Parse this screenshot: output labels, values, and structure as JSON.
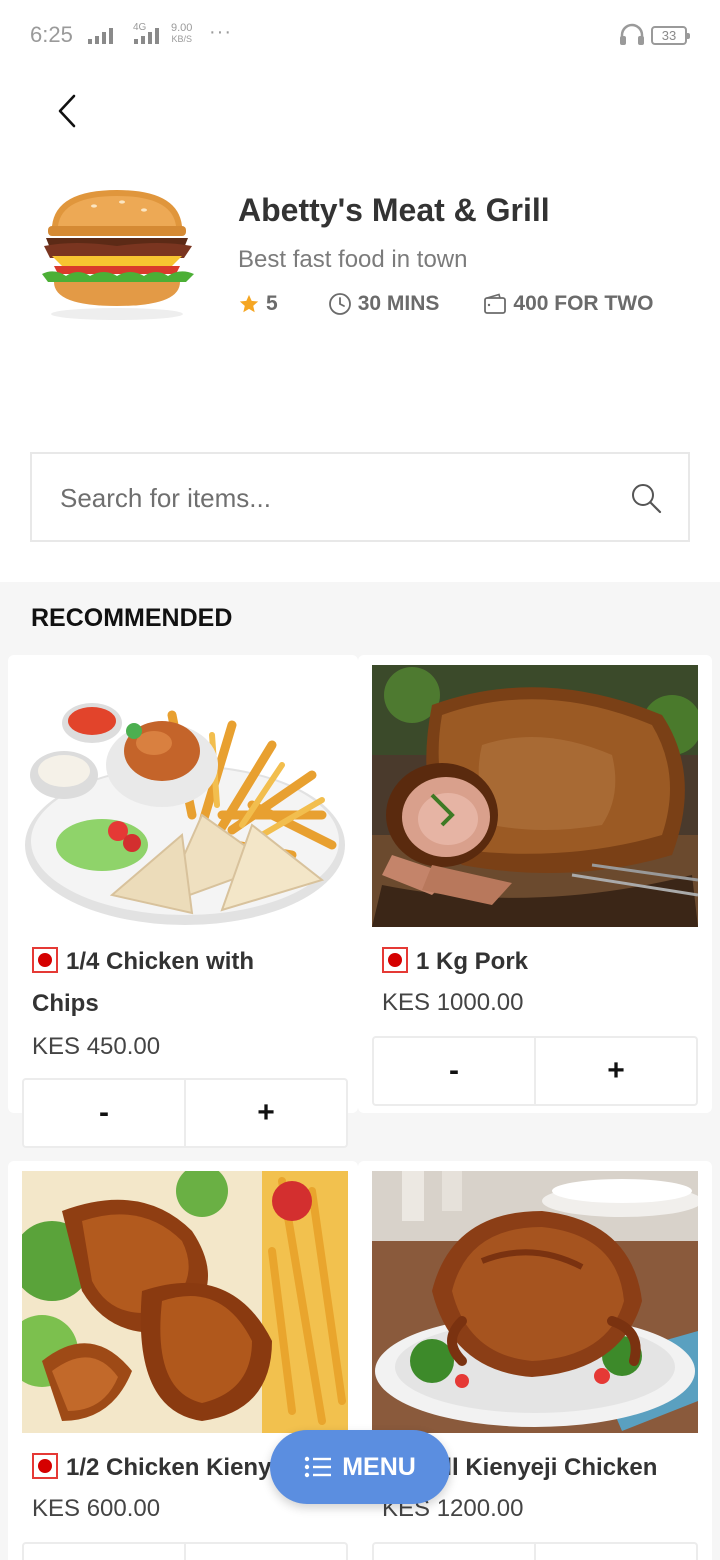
{
  "status_bar": {
    "time": "6:25",
    "network": "4G",
    "speed_value": "9.00",
    "speed_unit": "KB/S",
    "more": "···",
    "battery": "33"
  },
  "restaurant": {
    "name": "Abetty's Meat & Grill",
    "tagline": "Best fast food in town",
    "rating": "5",
    "delivery_time": "30 MINS",
    "cost_for_two": "400 FOR TWO"
  },
  "search": {
    "placeholder": "Search for items..."
  },
  "section": {
    "title": "RECOMMENDED"
  },
  "items": [
    {
      "name_line1": "1/4 Chicken with",
      "name_line2": "Chips",
      "price": "KES 450.00",
      "minus": "-",
      "plus": "+"
    },
    {
      "name_line1": "1 Kg Pork",
      "price": "KES 1000.00",
      "minus": "-",
      "plus": "+"
    },
    {
      "name_line1": "1/2 Chicken Kienyeji",
      "price": "KES 600.00"
    },
    {
      "name_line1": "Full Kienyeji Chicken",
      "price": "KES 1200.00"
    }
  ],
  "menu_button": {
    "label": "MENU"
  },
  "colors": {
    "accent": "#5b8ee0",
    "star": "#f5a623",
    "nonveg_mark": "#d50000"
  }
}
